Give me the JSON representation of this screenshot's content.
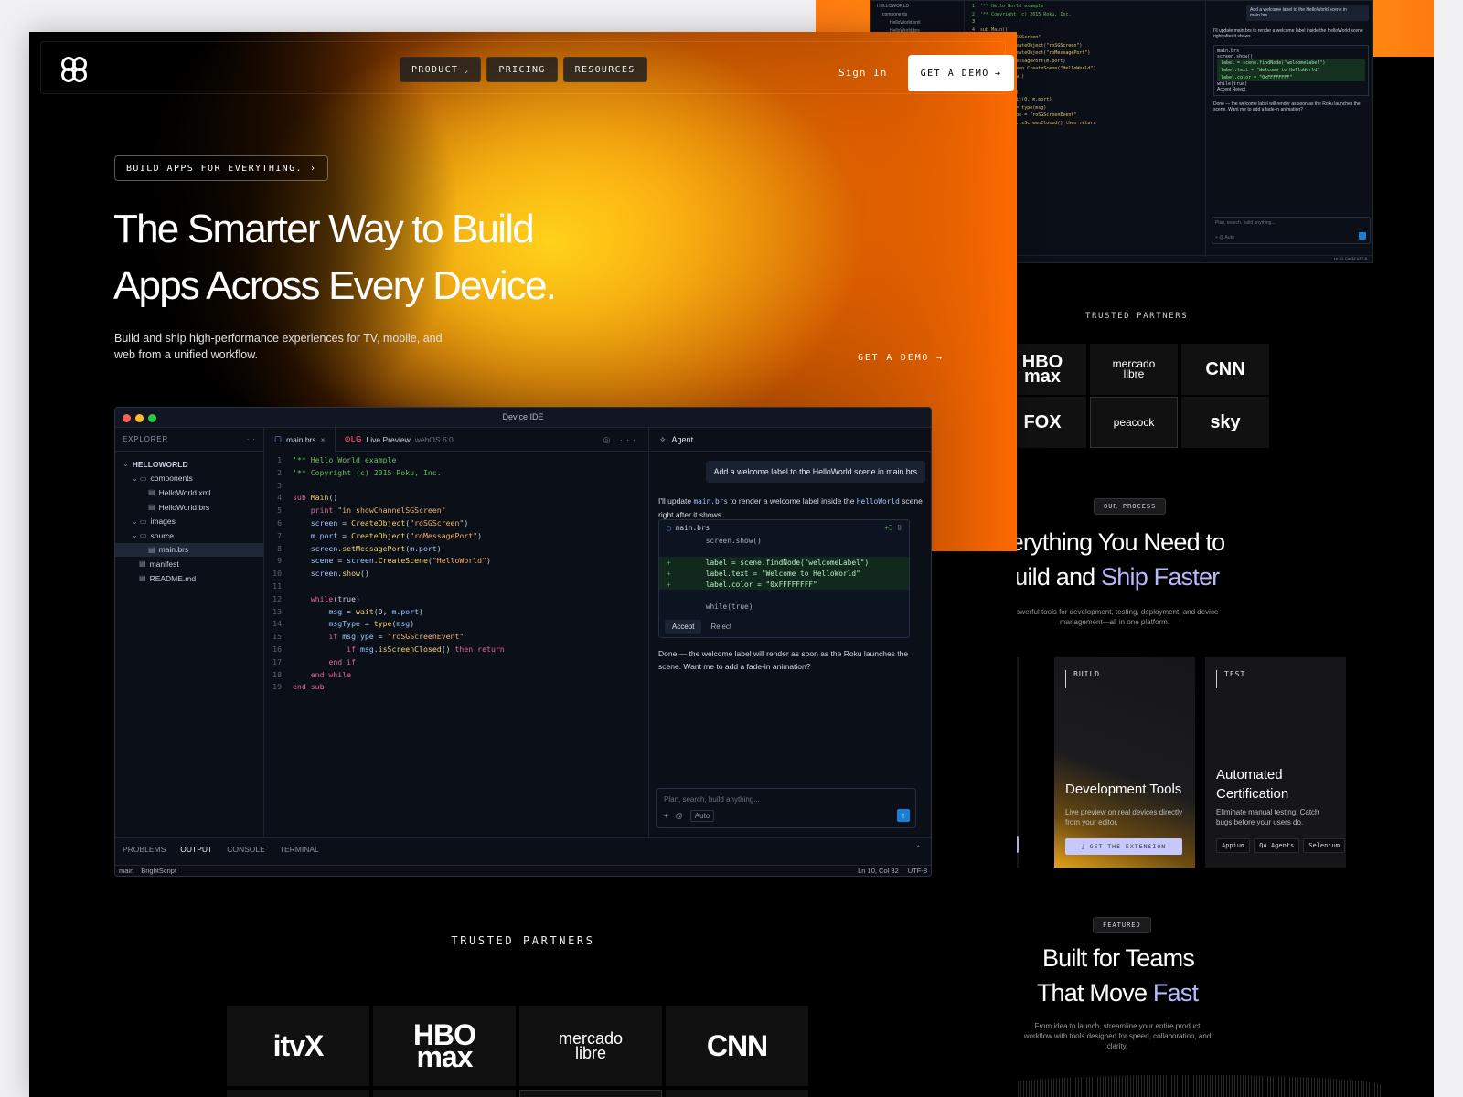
{
  "background_page": {
    "ide": {
      "tree": [
        "HELLOWORLD",
        "components",
        "HelloWorld.xml",
        "HelloWorld.brs"
      ],
      "code": [
        "'** Hello World example",
        "'** Copyright (c) 2015 Roku, Inc.",
        "",
        "sub Main()",
        "  showChannelSGScreen\"",
        "  screen = CreateObject(\"roSGScreen\")",
        "  m.port = CreateObject(\"roMessagePort\")",
        "  screen.setMessagePort(m.port)",
        "  scene = screen.CreateScene(\"HelloWorld\")",
        "  screen.show()",
        "",
        "  while(true)",
        "    msg = wait(0, m.port)",
        "    msgType = type(msg)",
        "    if msgType = \"roSGScreenEvent\"",
        "      if msg.isScreenClosed() then return"
      ],
      "user_msg": "Add a welcome label to the HelloWorld scene in main.brs",
      "agent_msg": "I'll update main.brs to render a welcome label inside the HelloWorld scene right after it shows.",
      "diff_file": "main.brs",
      "diff_lines": [
        "screen.show()",
        "label = scene.findNode(\"welcomeLabel\")",
        "label.text = \"Welcome to HelloWorld\"",
        "label.color = \"0xFFFFFFFF\"",
        "while(true)"
      ],
      "accept": "Accept",
      "reject": "Reject",
      "done_msg": "Done — the welcome label will render as soon as the Roku launches the scene. Want me to add a fade-in animation?",
      "placeholder": "Plan, search, build anything...",
      "auto": "Auto",
      "status": "Ln 10, Col 32   UTF-8"
    },
    "trusted_partners": "TRUSTED PARTNERS",
    "partners": [
      {
        "name": "HBO max",
        "line1": "HBO",
        "line2": "max"
      },
      {
        "name": "mercado libre",
        "line1": "mercado",
        "line2": "libre"
      },
      {
        "name": "CNN",
        "line1": "CNN",
        "line2": ""
      },
      {
        "name": "FOX",
        "line1": "FOX",
        "line2": ""
      },
      {
        "name": "peacock",
        "line1": "peacock",
        "line2": ""
      },
      {
        "name": "sky",
        "line1": "sky",
        "line2": ""
      }
    ],
    "process_pill": "OUR PROCESS",
    "process_title_1": "verything You Need to",
    "process_title_2a": "Build and ",
    "process_title_2b": "Ship Faster",
    "process_sub": "Powerful tools for development, testing, deployment, and device management—all in one platform.",
    "cards": [
      {
        "tag": "BUILD",
        "title": "Development Tools",
        "desc": "Live preview on real devices directly from your editor.",
        "button": "⤓  GET THE EXTENSION"
      },
      {
        "tag": "TEST",
        "title_1": "Automated",
        "title_2": "Certification",
        "desc": "Eliminate manual testing. Catch bugs before your users do.",
        "chips": [
          "Appium",
          "QA Agents",
          "Selenium"
        ]
      }
    ],
    "featured_pill": "FEATURED",
    "featured_title_1": "Built for Teams",
    "featured_title_2a": "That Move ",
    "featured_title_2b": "Fast",
    "featured_sub": "From idea to launch, streamline your entire product workflow with tools designed for speed, collaboration, and clarity."
  },
  "nav": {
    "links": [
      {
        "label": "PRODUCT",
        "has_chevron": true
      },
      {
        "label": "PRICING"
      },
      {
        "label": "RESOURCES"
      }
    ],
    "signin": "Sign In",
    "demo": "GET A DEMO"
  },
  "hero": {
    "badge": "BUILD APPS FOR EVERYTHING.",
    "title_1": "The Smarter Way to Build",
    "title_2": "Apps Across Every Device.",
    "subtitle": "Build and ship high-performance experiences for TV, mobile, and web from a unified workflow.",
    "cta": "GET A DEMO"
  },
  "ide": {
    "title": "Device IDE",
    "explorer_label": "EXPLORER",
    "tree": [
      {
        "label": "HELLOWORLD",
        "depth": 0,
        "type": "root"
      },
      {
        "label": "components",
        "depth": 1,
        "type": "folder"
      },
      {
        "label": "HelloWorld.xml",
        "depth": 2,
        "type": "file"
      },
      {
        "label": "HelloWorld.brs",
        "depth": 2,
        "type": "file"
      },
      {
        "label": "images",
        "depth": 1,
        "type": "folder"
      },
      {
        "label": "source",
        "depth": 1,
        "type": "folder"
      },
      {
        "label": "main.brs",
        "depth": 2,
        "type": "file",
        "active": true
      },
      {
        "label": "manifest",
        "depth": 1,
        "type": "file"
      },
      {
        "label": "README.md",
        "depth": 1,
        "type": "file"
      }
    ],
    "tabs": [
      {
        "label": "main.brs",
        "close": "×"
      },
      {
        "brand": "LG",
        "label": "Live Preview",
        "meta": "webOS 6.0"
      }
    ],
    "code": [
      "'** Hello World example",
      "'** Copyright (c) 2015 Roku, Inc.",
      "",
      "sub Main()",
      "    print \"in showChannelSGScreen\"",
      "    screen = CreateObject(\"roSGScreen\")",
      "    m.port = CreateObject(\"roMessagePort\")",
      "    screen.setMessagePort(m.port)",
      "    scene = screen.CreateScene(\"HelloWorld\")",
      "    screen.show()",
      "",
      "    while(true)",
      "        msg = wait(0, m.port)",
      "        msgType = type(msg)",
      "        if msgType = \"roSGScreenEvent\"",
      "            if msg.isScreenClosed() then return",
      "        end if",
      "    end while",
      "end sub"
    ],
    "agent": {
      "label": "Agent",
      "user_msg": "Add a welcome label to the HelloWorld scene in main.brs",
      "reply_pre": "I'll update ",
      "reply_code1": "main.brs",
      "reply_mid": " to render a welcome label inside the ",
      "reply_code2": "HelloWorld",
      "reply_post": " scene right after it shows.",
      "diff_file": "main.brs",
      "diff_add": "+3",
      "diff_del": "0",
      "diff": [
        {
          "type": "ctx",
          "text": "    screen.show()"
        },
        {
          "type": "blank",
          "text": ""
        },
        {
          "type": "add",
          "text": "    label = scene.findNode(\"welcomeLabel\")"
        },
        {
          "type": "add",
          "text": "    label.text = \"Welcome to HelloWorld\""
        },
        {
          "type": "add",
          "text": "    label.color = \"0xFFFFFFFF\""
        },
        {
          "type": "blank",
          "text": ""
        },
        {
          "type": "ctx",
          "text": "    while(true)"
        }
      ],
      "accept": "Accept",
      "reject": "Reject",
      "done": "Done — the welcome label will render as soon as the Roku launches the scene. Want me to add a fade-in animation?",
      "placeholder": "Plan, search, build anything...",
      "auto": "Auto"
    },
    "panel_tabs": [
      "PROBLEMS",
      "OUTPUT",
      "CONSOLE",
      "TERMINAL"
    ],
    "active_panel": "OUTPUT",
    "status_left": [
      "main",
      "BrightScript"
    ],
    "status_right": [
      "Ln 10, Col 32",
      "UTF-8"
    ]
  },
  "partners_label": "TRUSTED PARTNERS",
  "partners": [
    {
      "name": "itvX",
      "line1": "itvX",
      "line2": ""
    },
    {
      "name": "HBO max",
      "line1": "HBO",
      "line2": "max"
    },
    {
      "name": "mercado libre",
      "line1": "mercado",
      "line2": "libre"
    },
    {
      "name": "CNN",
      "line1": "CNN",
      "line2": ""
    }
  ],
  "colors": {
    "accent_orange": "#ff8a00",
    "accent_yellow": "#ffd21a",
    "accent_lavender": "#b8b8ff",
    "send_blue": "#1a7fd6"
  },
  "icons": [
    "logo-icon",
    "chevron-down-icon",
    "arrow-right-icon",
    "folder-icon",
    "file-icon",
    "spark-icon",
    "plus-icon",
    "at-icon",
    "send-icon"
  ]
}
